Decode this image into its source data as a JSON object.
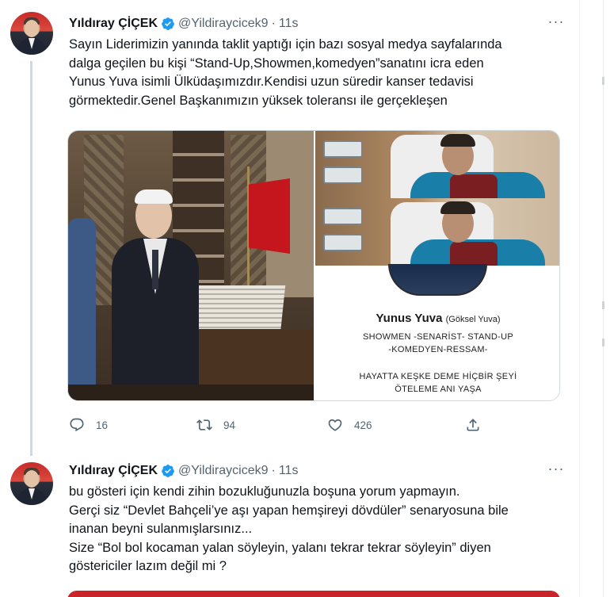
{
  "tweets": [
    {
      "author_name": "Yıldıray ÇİÇEK",
      "handle": "@Yildiraycicek9",
      "separator": "·",
      "time": "11s",
      "more": "···",
      "text_lines": [
        "Sayın Liderimizin yanında taklit yaptığı için bazı sosyal medya sayfalarında",
        "dalga geçilen bu kişi “Stand-Up,Showmen,komedyen”sanatını icra eden",
        "Yunus Yuva isimli Ülküdaşımızdır.Kendisi uzun süredir kanser tedavisi",
        "görmektedir.Genel Başkanımızın yüksek toleransı ile gerçekleşen"
      ],
      "media": {
        "profile_name": "Yunus Yuva",
        "profile_realname": "(Göksel Yuva)",
        "profile_tags_line1": "SHOWMEN -SENARİST- STAND-UP",
        "profile_tags_line2": "-KOMEDYEN-RESSAM-",
        "motto_line1": "HAYATTA KEŞKE DEME HİÇBİR ŞEYİ",
        "motto_line2": "ÖTELEME ANI YAŞA"
      },
      "actions": {
        "reply_count": "16",
        "retweet_count": "94",
        "like_count": "426"
      }
    },
    {
      "author_name": "Yıldıray ÇİÇEK",
      "handle": "@Yildiraycicek9",
      "separator": "·",
      "time": "11s",
      "more": "···",
      "text_lines": [
        "bu gösteri için kendi zihin bozukluğunuzla boşuna yorum yapmayın.",
        "Gerçi siz “Devlet Bahçeli’ye aşı yapan hemşireyi dövdüler” senaryosuna bile",
        "inanan beyni sulanmışlarsınız...",
        "Size “Bol bol kocaman yalan söyleyin, yalanı tekrar tekrar söyleyin” diyen",
        "göstericiler lazım değil mi ?"
      ]
    }
  ],
  "colors": {
    "verified": "#1d9bf0",
    "muted": "#536471",
    "thread_line": "#cfd9de"
  },
  "icons": [
    "verified-badge-icon",
    "more-icon",
    "reply-icon",
    "retweet-icon",
    "like-icon",
    "share-icon"
  ]
}
